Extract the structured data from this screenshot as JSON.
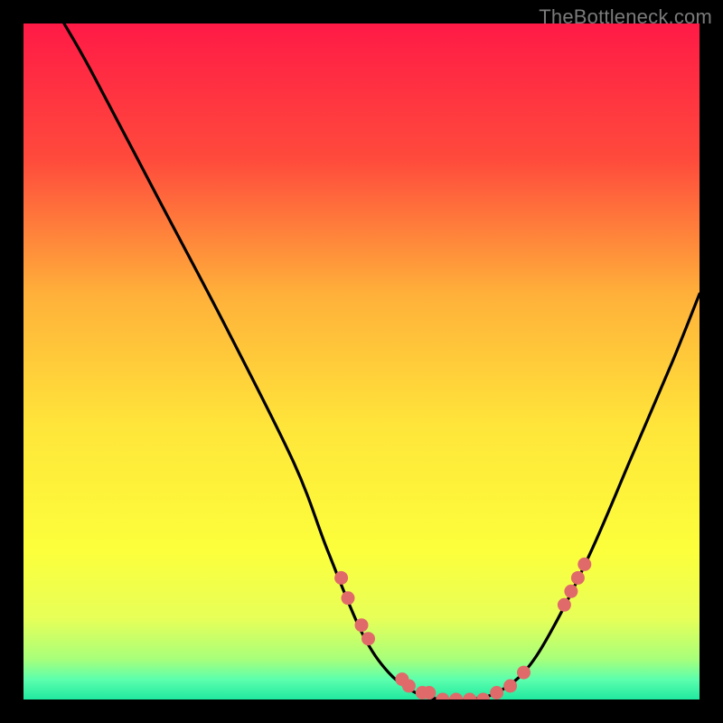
{
  "watermark": "TheBottleneck.com",
  "chart_data": {
    "type": "line",
    "title": "",
    "xlabel": "",
    "ylabel": "",
    "xlim": [
      0,
      100
    ],
    "ylim": [
      0,
      100
    ],
    "curve": [
      {
        "x": 6,
        "y": 100
      },
      {
        "x": 10,
        "y": 93
      },
      {
        "x": 20,
        "y": 74
      },
      {
        "x": 30,
        "y": 55
      },
      {
        "x": 40,
        "y": 35
      },
      {
        "x": 45,
        "y": 22
      },
      {
        "x": 50,
        "y": 10
      },
      {
        "x": 54,
        "y": 4
      },
      {
        "x": 58,
        "y": 1
      },
      {
        "x": 62,
        "y": 0
      },
      {
        "x": 66,
        "y": 0
      },
      {
        "x": 70,
        "y": 1
      },
      {
        "x": 74,
        "y": 4
      },
      {
        "x": 78,
        "y": 10
      },
      {
        "x": 84,
        "y": 22
      },
      {
        "x": 90,
        "y": 36
      },
      {
        "x": 96,
        "y": 50
      },
      {
        "x": 100,
        "y": 60
      }
    ],
    "markers": [
      {
        "x": 47,
        "y": 18
      },
      {
        "x": 48,
        "y": 15
      },
      {
        "x": 50,
        "y": 11
      },
      {
        "x": 51,
        "y": 9
      },
      {
        "x": 56,
        "y": 3
      },
      {
        "x": 57,
        "y": 2
      },
      {
        "x": 59,
        "y": 1
      },
      {
        "x": 60,
        "y": 1
      },
      {
        "x": 62,
        "y": 0
      },
      {
        "x": 64,
        "y": 0
      },
      {
        "x": 66,
        "y": 0
      },
      {
        "x": 68,
        "y": 0
      },
      {
        "x": 70,
        "y": 1
      },
      {
        "x": 72,
        "y": 2
      },
      {
        "x": 74,
        "y": 4
      },
      {
        "x": 80,
        "y": 14
      },
      {
        "x": 81,
        "y": 16
      },
      {
        "x": 82,
        "y": 18
      },
      {
        "x": 83,
        "y": 20
      }
    ],
    "gradient_stops": [
      {
        "offset": 0.0,
        "color": "#ff1a46"
      },
      {
        "offset": 0.2,
        "color": "#ff4a3c"
      },
      {
        "offset": 0.4,
        "color": "#ffb03a"
      },
      {
        "offset": 0.6,
        "color": "#ffe63a"
      },
      {
        "offset": 0.78,
        "color": "#fcff3b"
      },
      {
        "offset": 0.88,
        "color": "#e7ff58"
      },
      {
        "offset": 0.94,
        "color": "#a8ff7a"
      },
      {
        "offset": 0.97,
        "color": "#5dffad"
      },
      {
        "offset": 1.0,
        "color": "#20e9a0"
      }
    ],
    "marker_color": "#e06a6a",
    "curve_color": "#000000"
  }
}
